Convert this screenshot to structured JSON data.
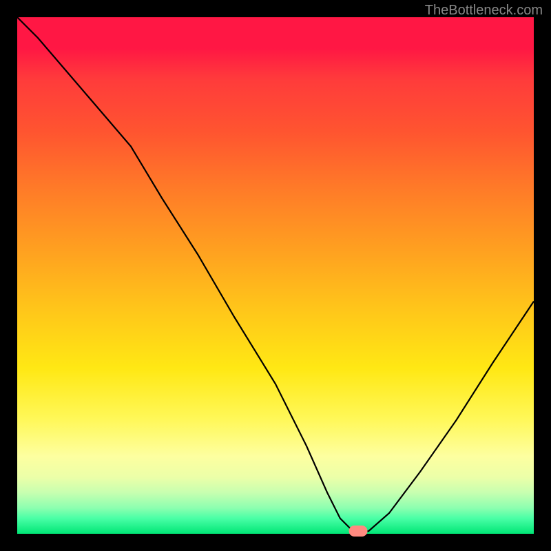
{
  "watermark": "TheBottleneck.com",
  "chart_data": {
    "type": "line",
    "title": "",
    "xlabel": "",
    "ylabel": "",
    "xlim": [
      0,
      100
    ],
    "ylim": [
      0,
      100
    ],
    "grid": false,
    "legend": false,
    "background": "gradient-red-to-green",
    "series": [
      {
        "name": "bottleneck-curve",
        "x": [
          0,
          4,
          10,
          16,
          22,
          28,
          35,
          42,
          50,
          56,
          60,
          62.5,
          65,
          68,
          72,
          78,
          85,
          92,
          100
        ],
        "y": [
          100,
          96,
          89,
          82,
          75,
          65,
          54,
          42,
          29,
          17,
          8,
          3,
          0.5,
          0.5,
          4,
          12,
          22,
          33,
          45
        ],
        "color": "#000000"
      }
    ],
    "marker": {
      "x": 66,
      "y": 0.5,
      "color": "#ff8a80",
      "shape": "pill"
    },
    "gradient_stops": [
      {
        "pos": 0,
        "color": "#ff1744"
      },
      {
        "pos": 12,
        "color": "#ff3b3b"
      },
      {
        "pos": 33,
        "color": "#ff7a28"
      },
      {
        "pos": 56,
        "color": "#ffc41a"
      },
      {
        "pos": 78,
        "color": "#fff85a"
      },
      {
        "pos": 92,
        "color": "#c8ffb0"
      },
      {
        "pos": 100,
        "color": "#00e676"
      }
    ]
  }
}
